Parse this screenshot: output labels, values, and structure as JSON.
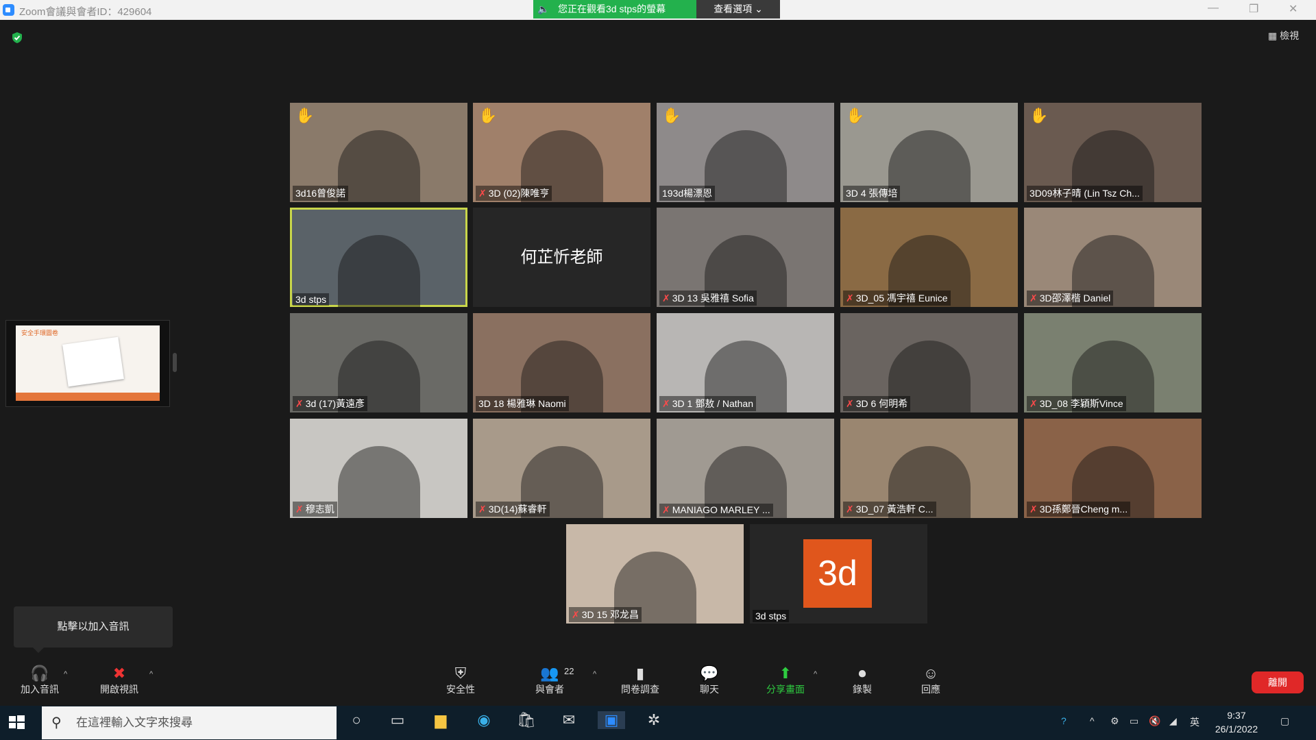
{
  "window": {
    "title": "Zoom會議與會者ID：429604",
    "viewing_banner": "您正在觀看3d stps的螢幕",
    "view_options": "查看選項 ⌄",
    "view_button": "檢視"
  },
  "tooltip": "點擊以加入音訊",
  "grid": {
    "tiles": [
      {
        "name": "3d16曾俊諾",
        "muted": false,
        "hand": true,
        "bg": "#8a7a6a"
      },
      {
        "name": "3D (02)陳唯亨",
        "muted": true,
        "hand": true,
        "bg": "#a0806a"
      },
      {
        "name": "193d楊漂恩",
        "muted": false,
        "hand": true,
        "bg": "#8e8a8a"
      },
      {
        "name": "3D 4 張傳培",
        "muted": false,
        "hand": true,
        "bg": "#9a9890"
      },
      {
        "name": "3D09林子晴 (Lin Tsz Ch...",
        "muted": false,
        "hand": true,
        "bg": "#6a5a50"
      },
      {
        "name": "3d stps",
        "muted": false,
        "hand": false,
        "bg": "#5a6268",
        "active": true
      },
      {
        "name": "",
        "muted": false,
        "hand": false,
        "bg": "#262626",
        "label": "何芷忻老師"
      },
      {
        "name": "3D 13 吳雅禧 Sofia",
        "muted": true,
        "hand": false,
        "bg": "#7a7572"
      },
      {
        "name": "3D_05 馮宇禧 Eunice",
        "muted": true,
        "hand": false,
        "bg": "#8a6a44"
      },
      {
        "name": "3D邵澤楷 Daniel",
        "muted": true,
        "hand": false,
        "bg": "#9a8878"
      },
      {
        "name": "3d (17)黃遠彥",
        "muted": true,
        "hand": false,
        "bg": "#6a6a66"
      },
      {
        "name": "3D 18 楊雅琳 Naomi",
        "muted": false,
        "hand": false,
        "bg": "#8a7060"
      },
      {
        "name": "3D 1 鄧敖 / Nathan",
        "muted": true,
        "hand": false,
        "bg": "#b8b6b4"
      },
      {
        "name": "3D 6 何明希",
        "muted": true,
        "hand": false,
        "bg": "#6a6460"
      },
      {
        "name": "3D_08 李穎斯Vince",
        "muted": true,
        "hand": false,
        "bg": "#7a8070"
      },
      {
        "name": "穆志凱",
        "muted": true,
        "hand": false,
        "bg": "#c8c6c2"
      },
      {
        "name": "3D(14)蘇睿軒",
        "muted": true,
        "hand": false,
        "bg": "#a89a8a"
      },
      {
        "name": "MANIAGO MARLEY ...",
        "muted": true,
        "hand": false,
        "bg": "#a09a92"
      },
      {
        "name": "3D_07 黃浩軒 C...",
        "muted": true,
        "hand": false,
        "bg": "#9a8670"
      },
      {
        "name": "3D孫鄭晉Cheng m...",
        "muted": true,
        "hand": false,
        "bg": "#8a6248"
      },
      {
        "name": "3D 15 邓龙昌",
        "muted": true,
        "hand": false,
        "bg": "#c8b8a8"
      },
      {
        "name": "3d stps",
        "muted": false,
        "hand": false,
        "bg": "#262626",
        "avatar": "3d"
      }
    ]
  },
  "thumbnail": {
    "header": "安全手環圖卷"
  },
  "toolbar": {
    "join_audio": "加入音訊",
    "start_video": "開啟視訊",
    "security": "安全性",
    "participants": "與會者",
    "participants_count": "22",
    "polls": "問卷調查",
    "chat": "聊天",
    "share_screen": "分享畫面",
    "record": "錄製",
    "reactions": "回應",
    "leave": "離開"
  },
  "taskbar": {
    "search_placeholder": "在這裡輸入文字來搜尋",
    "ime": "英",
    "time": "9:37",
    "date": "26/1/2022"
  }
}
